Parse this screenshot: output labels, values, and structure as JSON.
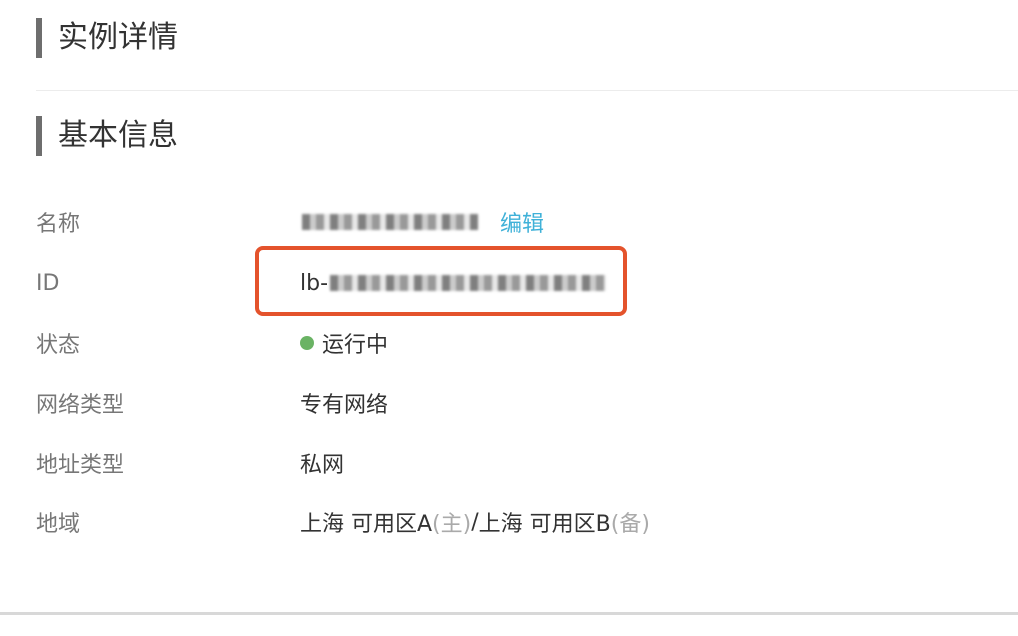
{
  "sections": {
    "instance_details_title": "实例详情",
    "basic_info_title": "基本信息"
  },
  "basic_info": {
    "name": {
      "label": "名称",
      "edit_label": "编辑"
    },
    "id": {
      "label": "ID",
      "value_prefix": "lb-"
    },
    "status": {
      "label": "状态",
      "value": "运行中",
      "dot_color": "#6ab364"
    },
    "network_type": {
      "label": "网络类型",
      "value": "专有网络"
    },
    "address_type": {
      "label": "地址类型",
      "value": "私网"
    },
    "region": {
      "label": "地域",
      "primary": "上海 可用区A",
      "primary_note": "(主)",
      "separator": "/",
      "backup": "上海 可用区B",
      "backup_note": "(备)"
    }
  },
  "colors": {
    "highlight": "#e4532c",
    "link": "#3fb1d8"
  }
}
